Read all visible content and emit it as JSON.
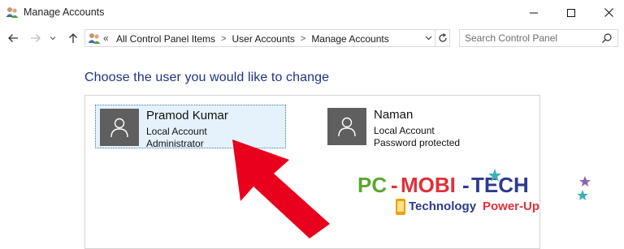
{
  "window": {
    "title": "Manage Accounts",
    "icon": "user-accounts-icon"
  },
  "nav": {
    "overflow": "«",
    "breadcrumbs": [
      "All Control Panel Items",
      "User Accounts",
      "Manage Accounts"
    ],
    "search_placeholder": "Search Control Panel"
  },
  "main": {
    "heading": "Choose the user you would like to change",
    "accounts": [
      {
        "name": "Pramod Kumar",
        "type": "Local Account",
        "detail": "Administrator",
        "selected": true
      },
      {
        "name": "Naman",
        "type": "Local Account",
        "detail": "Password protected",
        "selected": false
      }
    ]
  },
  "overlay": {
    "arrow_color": "#e8001c",
    "watermark": {
      "logo_text": "PC-MOBI-TECH",
      "tagline": "Technology Power-Up"
    }
  }
}
